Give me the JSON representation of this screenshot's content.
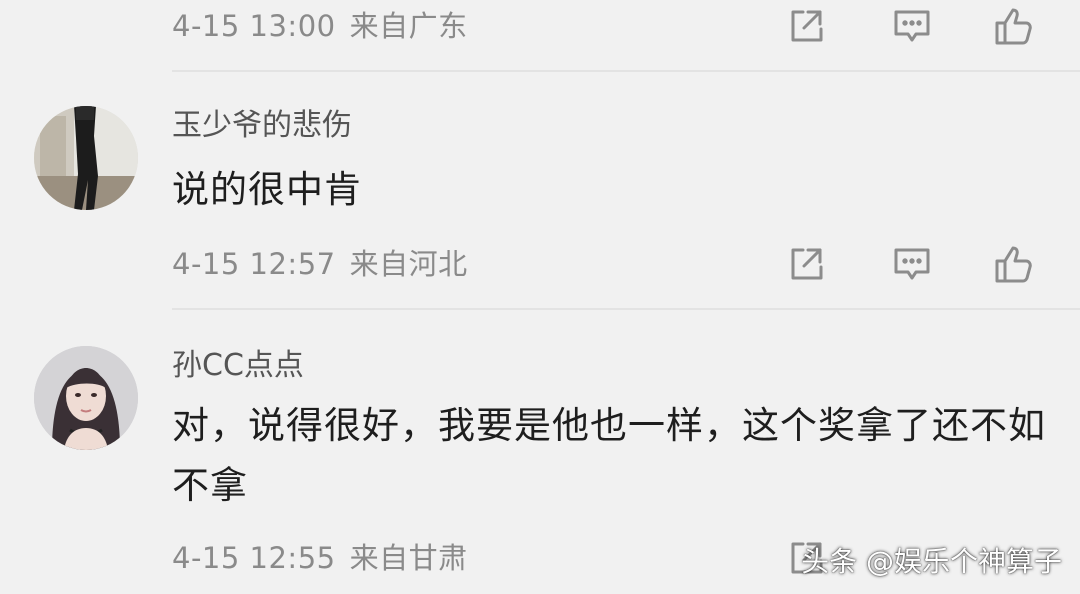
{
  "comments": [
    {
      "timestamp": "4-15 13:00",
      "region": "来自广东"
    },
    {
      "username": "玉少爷的悲伤",
      "text": "说的很中肯",
      "timestamp": "4-15 12:57",
      "region": "来自河北",
      "avatar_icon": "avatar-person-standing"
    },
    {
      "username": "孙CC点点",
      "text": "对，说得很好，我要是他也一样，这个奖拿了还不如不拿",
      "timestamp": "4-15 12:55",
      "region": "来自甘肃",
      "avatar_icon": "avatar-girl-portrait"
    }
  ],
  "actions": {
    "share_icon": "share-icon",
    "reply_icon": "comment-icon",
    "like_icon": "thumbs-up-icon"
  },
  "watermark": "头条 @娱乐个神算子",
  "colors": {
    "background": "#f1f1f1",
    "meta_text": "#8a8a8a",
    "username": "#555555",
    "comment_text": "#1e1e1e",
    "icon": "#8c8c8c"
  }
}
